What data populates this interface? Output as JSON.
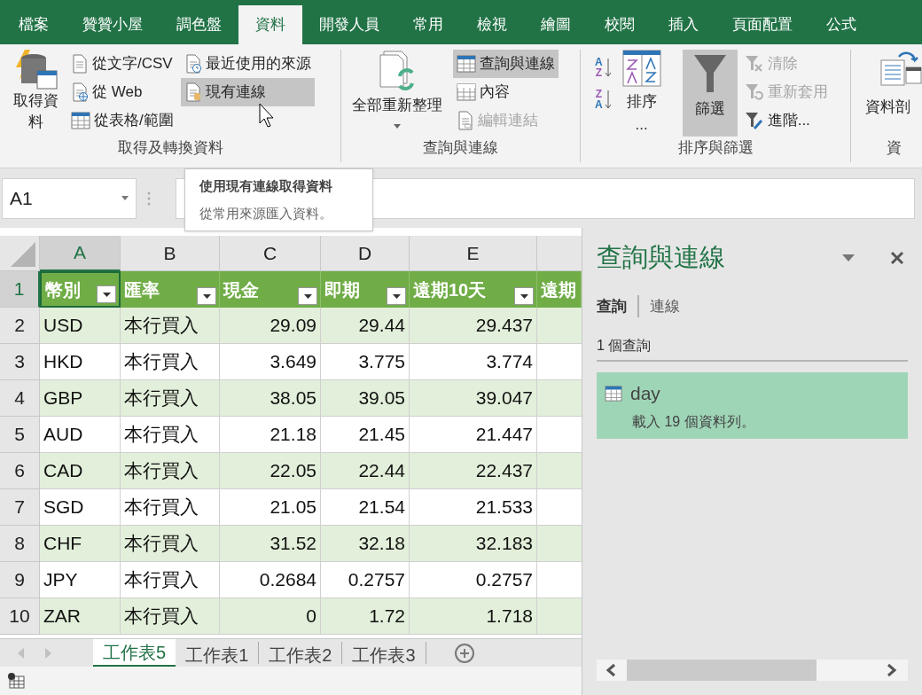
{
  "ribbon_tabs": [
    {
      "label": "檔案",
      "selected": false
    },
    {
      "label": "贊贊小屋",
      "selected": false
    },
    {
      "label": "調色盤",
      "selected": false
    },
    {
      "label": "資料",
      "selected": true
    },
    {
      "label": "開發人員",
      "selected": false
    },
    {
      "label": "常用",
      "selected": false
    },
    {
      "label": "檢視",
      "selected": false
    },
    {
      "label": "繪圖",
      "selected": false
    },
    {
      "label": "校閱",
      "selected": false
    },
    {
      "label": "插入",
      "selected": false
    },
    {
      "label": "頁面配置",
      "selected": false
    },
    {
      "label": "公式",
      "selected": false
    }
  ],
  "ribbon_groups": [
    {
      "label": "取得及轉換資料",
      "large": {
        "label": "取得資料",
        "selected": false
      },
      "columns": [
        [
          {
            "label": "從文字/CSV",
            "selected": false,
            "disabled": false
          },
          {
            "label": "從 Web",
            "selected": false,
            "disabled": false
          },
          {
            "label": "從表格/範圍",
            "selected": false,
            "disabled": false
          }
        ],
        [
          {
            "label": "最近使用的來源",
            "selected": false,
            "disabled": false
          },
          {
            "label": "現有連線",
            "selected": true,
            "disabled": false
          }
        ]
      ]
    },
    {
      "label": "查詢與連線",
      "large": {
        "label": "全部重新整理",
        "selected": false
      },
      "columns": [
        [
          {
            "label": "查詢與連線",
            "selected": true,
            "disabled": false
          },
          {
            "label": "內容",
            "selected": false,
            "disabled": false
          },
          {
            "label": "編輯連結",
            "selected": false,
            "disabled": true
          }
        ]
      ]
    },
    {
      "label": "排序與篩選",
      "sort_ascending": [
        "A",
        "Z"
      ],
      "sort_descending": [
        "Z",
        "A"
      ],
      "sort": {
        "label": "排序",
        "suffix": "..."
      },
      "filter": {
        "label": "篩選",
        "selected": true
      },
      "columns": [
        [
          {
            "label": "清除",
            "selected": false,
            "disabled": true
          },
          {
            "label": "重新套用",
            "selected": false,
            "disabled": true
          },
          {
            "label": "進階...",
            "selected": false,
            "disabled": false
          }
        ]
      ]
    },
    {
      "label": "資",
      "large": {
        "label": "資料剖",
        "selected": false
      }
    }
  ],
  "name_box": "A1",
  "tooltip": {
    "title": "使用現有連線取得資料",
    "body": "從常用來源匯入資料。"
  },
  "sheet": {
    "columns": [
      {
        "label": "A",
        "selected": true
      },
      {
        "label": "B",
        "selected": false
      },
      {
        "label": "C",
        "selected": false
      },
      {
        "label": "D",
        "selected": false
      },
      {
        "label": "E",
        "selected": false
      }
    ],
    "header_row": {
      "number": "1",
      "cells": [
        "幣別",
        "匯率",
        "現金",
        "即期",
        "遠期10天",
        "遠期"
      ]
    },
    "rows": [
      {
        "number": "2",
        "cells": [
          "USD",
          "本行買入",
          "29.09",
          "29.44",
          "29.437"
        ]
      },
      {
        "number": "3",
        "cells": [
          "HKD",
          "本行買入",
          "3.649",
          "3.775",
          "3.774"
        ]
      },
      {
        "number": "4",
        "cells": [
          "GBP",
          "本行買入",
          "38.05",
          "39.05",
          "39.047"
        ]
      },
      {
        "number": "5",
        "cells": [
          "AUD",
          "本行買入",
          "21.18",
          "21.45",
          "21.447"
        ]
      },
      {
        "number": "6",
        "cells": [
          "CAD",
          "本行買入",
          "22.05",
          "22.44",
          "22.437"
        ]
      },
      {
        "number": "7",
        "cells": [
          "SGD",
          "本行買入",
          "21.05",
          "21.54",
          "21.533"
        ]
      },
      {
        "number": "8",
        "cells": [
          "CHF",
          "本行買入",
          "31.52",
          "32.18",
          "32.183"
        ]
      },
      {
        "number": "9",
        "cells": [
          "JPY",
          "本行買入",
          "0.2684",
          "0.2757",
          "0.2757"
        ]
      },
      {
        "number": "10",
        "cells": [
          "ZAR",
          "本行買入",
          "0",
          "1.72",
          "1.718"
        ]
      }
    ]
  },
  "sheet_tabs": [
    {
      "label": "工作表5",
      "selected": true
    },
    {
      "label": "工作表1",
      "selected": false
    },
    {
      "label": "工作表2",
      "selected": false
    },
    {
      "label": "工作表3",
      "selected": false
    }
  ],
  "pane": {
    "title": "查詢與連線",
    "tabs": [
      {
        "label": "查詢",
        "selected": true
      },
      {
        "label": "連線",
        "selected": false
      }
    ],
    "count": "1 個查詢",
    "queries": [
      {
        "name": "day",
        "status": "載入 19 個資料列。",
        "selected": true
      }
    ]
  }
}
